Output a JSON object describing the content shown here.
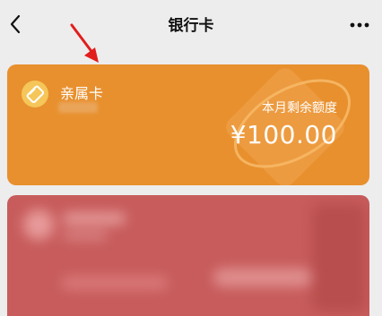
{
  "header": {
    "title": "银行卡",
    "back_icon": "chevron-left-icon",
    "more_icon": "more-dots-icon"
  },
  "kinship_card": {
    "name": "亲属卡",
    "quota_label": "本月剩余额度",
    "quota_amount": "¥100.00",
    "logo_icon": "kinship-card-logo-icon",
    "color": "#e8902e"
  },
  "bank_card": {
    "color": "#c85c5c"
  },
  "colors": {
    "background": "#ededed",
    "annotation_arrow": "#e21d1d"
  }
}
